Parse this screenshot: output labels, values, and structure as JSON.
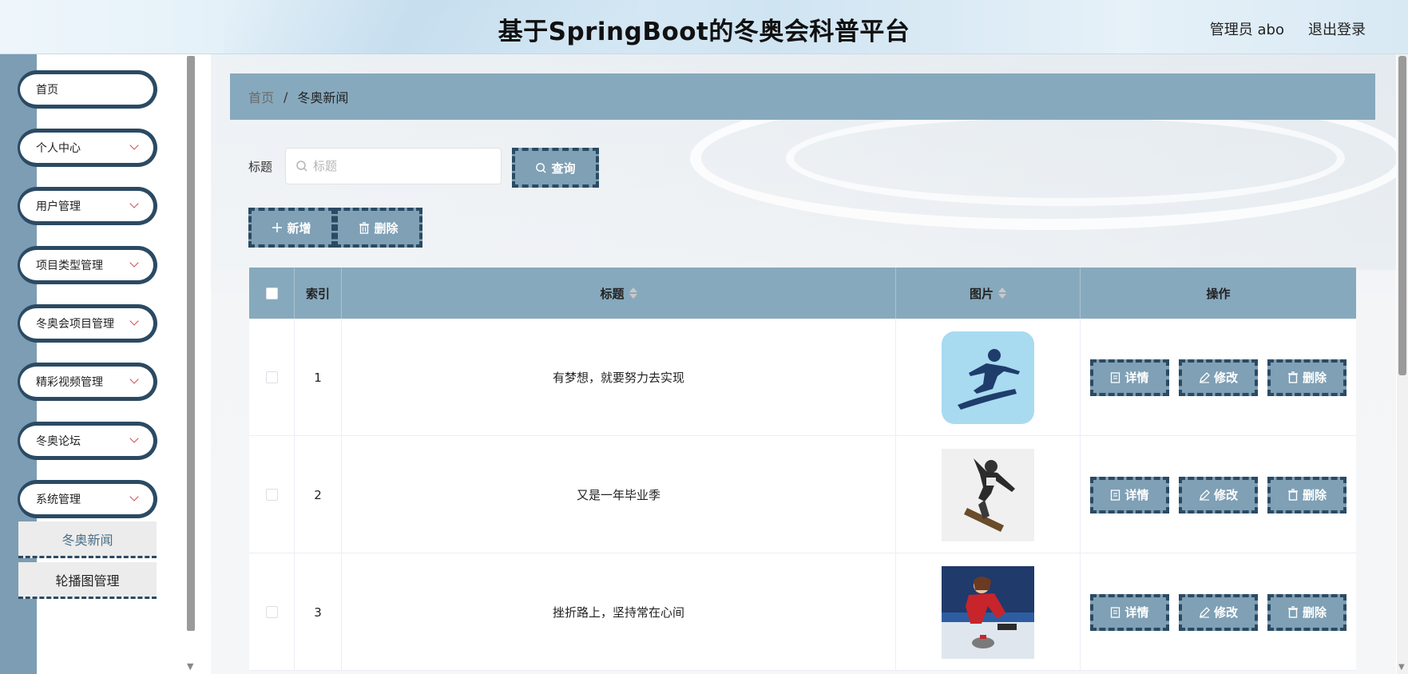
{
  "header": {
    "title": "基于SpringBoot的冬奥会科普平台",
    "user_label": "管理员 abo",
    "logout_label": "退出登录"
  },
  "sidebar": {
    "items": [
      {
        "label": "首页",
        "has_chevron": false
      },
      {
        "label": "个人中心",
        "has_chevron": true
      },
      {
        "label": "用户管理",
        "has_chevron": true
      },
      {
        "label": "项目类型管理",
        "has_chevron": true
      },
      {
        "label": "冬奥会项目管理",
        "has_chevron": true
      },
      {
        "label": "精彩视频管理",
        "has_chevron": true
      },
      {
        "label": "冬奥论坛",
        "has_chevron": true
      },
      {
        "label": "系统管理",
        "has_chevron": true
      }
    ],
    "submenu": [
      {
        "label": "冬奥新闻",
        "active": true
      },
      {
        "label": "轮播图管理",
        "active": false
      }
    ]
  },
  "breadcrumb": {
    "home": "首页",
    "separator": "/",
    "current": "冬奥新闻"
  },
  "search": {
    "label": "标题",
    "placeholder": "标题",
    "value": "",
    "button_label": "查询"
  },
  "toolbar": {
    "add_label": "新增",
    "delete_label": "删除"
  },
  "table": {
    "columns": [
      "",
      "索引",
      "标题",
      "图片",
      "操作"
    ],
    "rows": [
      {
        "index": "1",
        "title": "有梦想，就要努力去实现",
        "image": "snowboard-pictogram"
      },
      {
        "index": "2",
        "title": "又是一年毕业季",
        "image": "snowboarder-photo"
      },
      {
        "index": "3",
        "title": "挫折路上，坚持常在心间",
        "image": "curling-photo"
      }
    ],
    "actions": {
      "detail": "详情",
      "edit": "修改",
      "delete": "删除"
    }
  },
  "colors": {
    "accent": "#87a9bd",
    "button_fill": "#7fa0b5",
    "dark_border": "#2b4a63",
    "sidebar_strip": "#7c9db3"
  }
}
